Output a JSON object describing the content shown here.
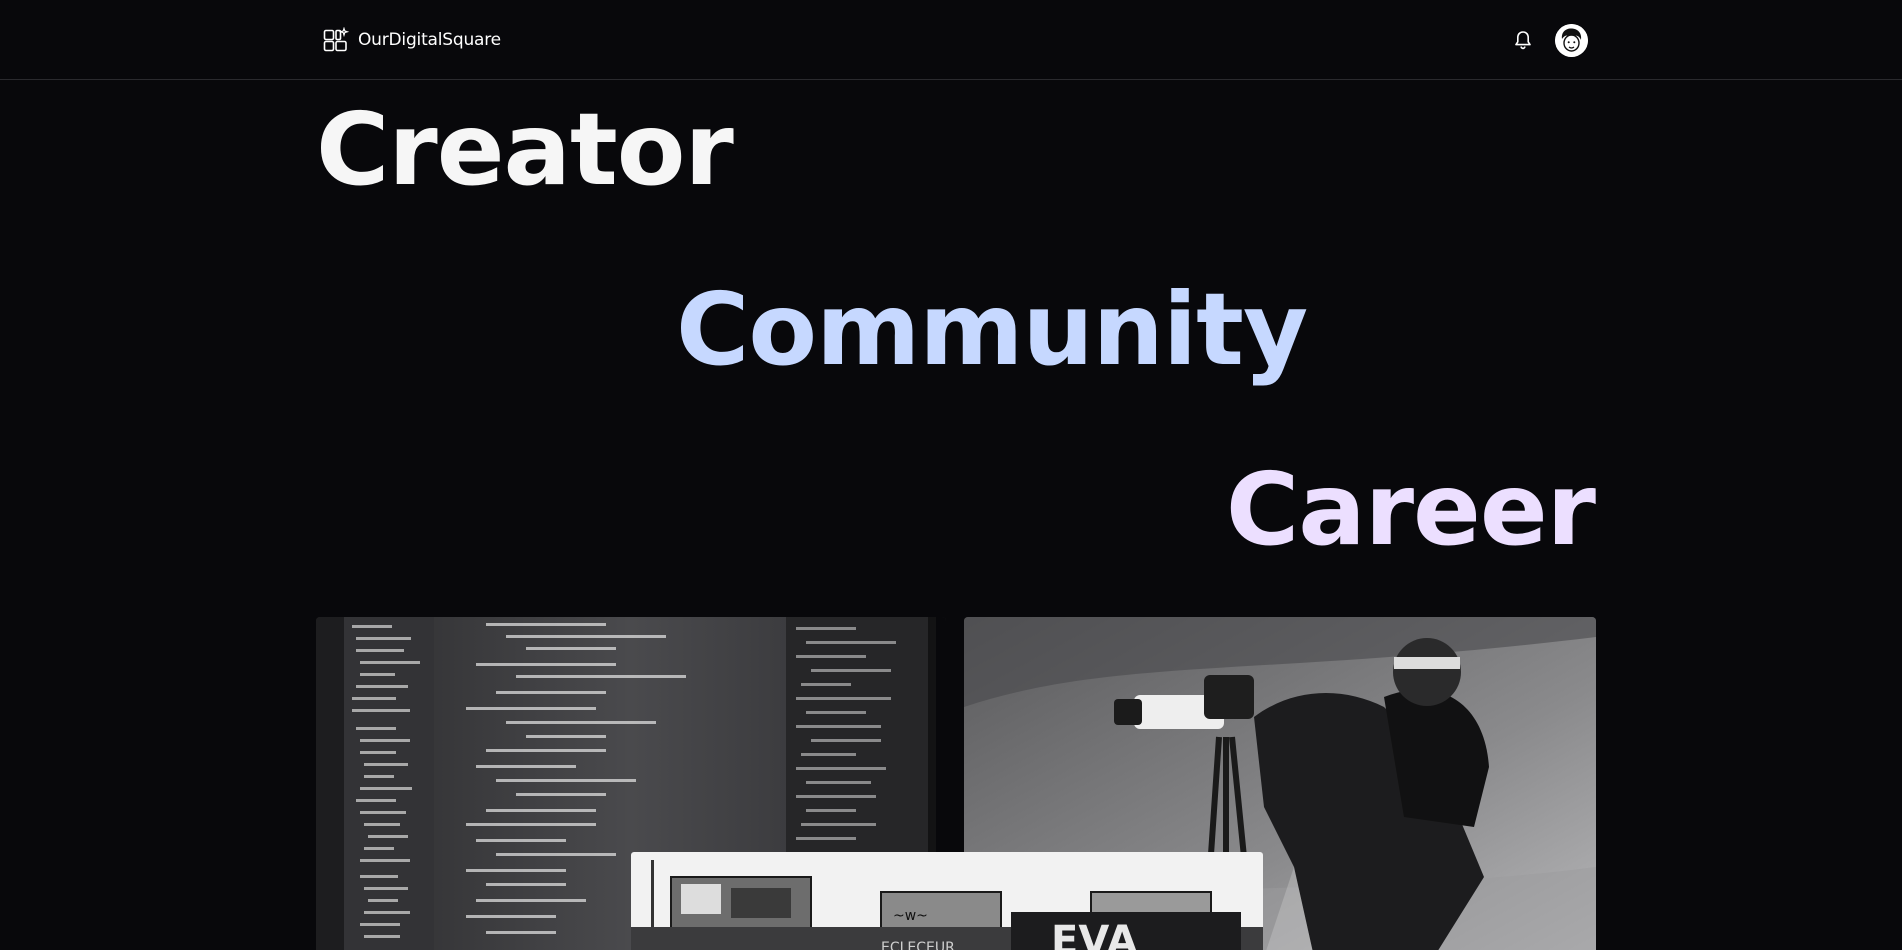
{
  "header": {
    "brand_name": "OurDigitalSquare",
    "brand_icon": "grid-sparkle-icon",
    "notification_icon": "bell-icon",
    "avatar_icon": "avatar"
  },
  "hero": {
    "word1": "Creator",
    "word2": "Community",
    "word3": "Career"
  },
  "colors": {
    "background": "#08080b",
    "word1": "#f6f6f6",
    "word2": "#c6d8ff",
    "word3": "#ecdfff"
  },
  "images": {
    "left": "code-on-monitor",
    "right": "photographer-with-camera",
    "center": "graffiti-wall",
    "center_sign": "EVA"
  }
}
